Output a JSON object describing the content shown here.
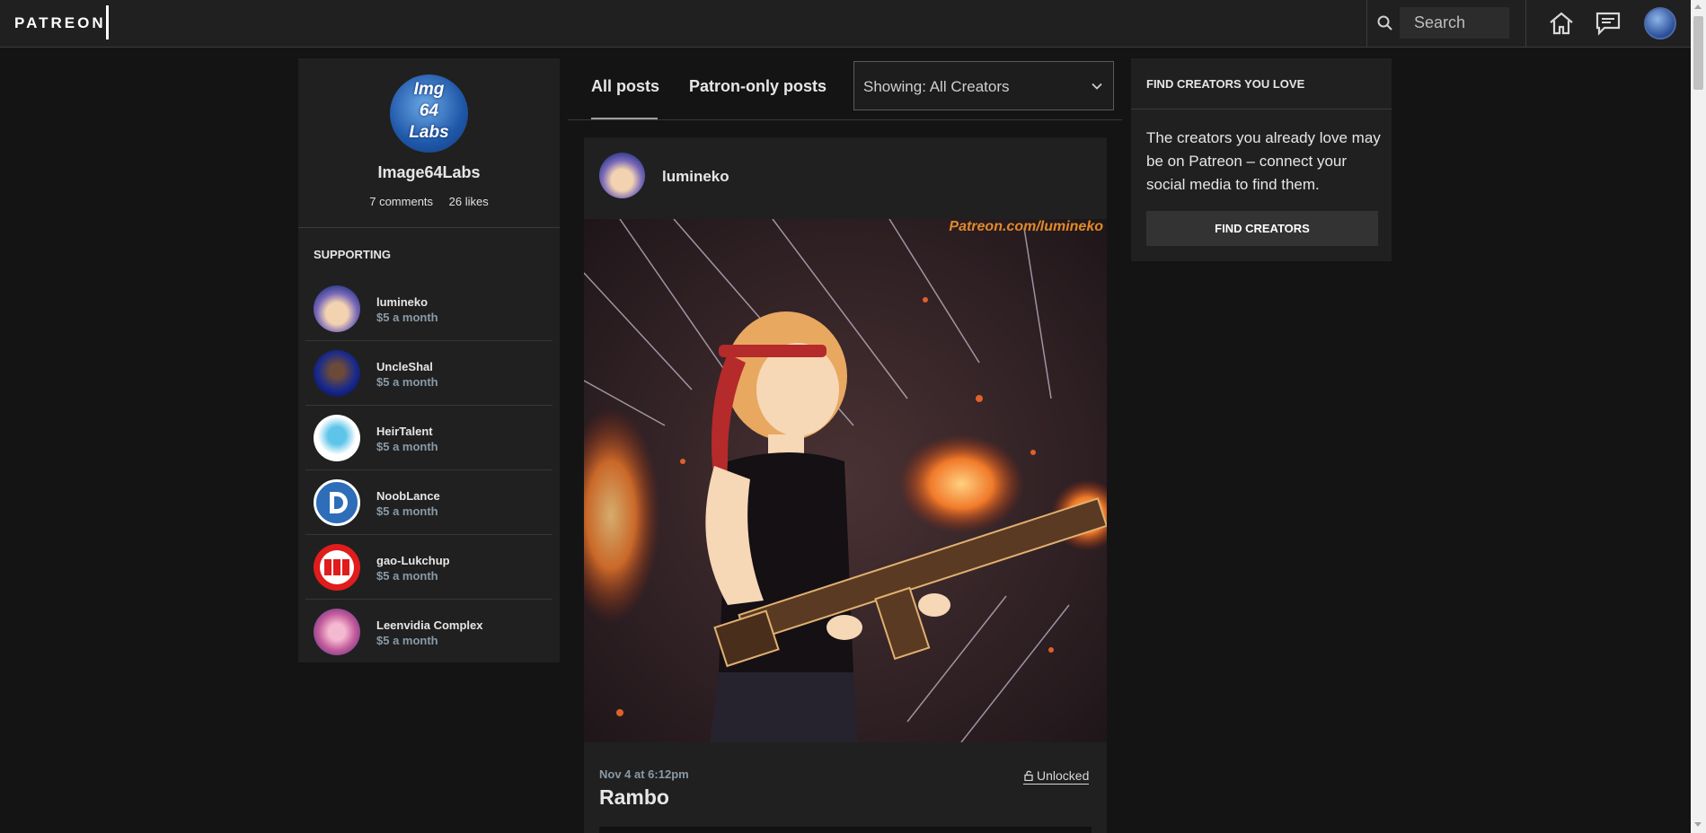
{
  "header": {
    "logo": "PATREON",
    "search_placeholder": "Search",
    "icons": [
      "search-icon",
      "home-icon",
      "messages-icon",
      "user-avatar"
    ]
  },
  "profile": {
    "name": "Image64Labs",
    "avatar_text": [
      "Img",
      "64",
      "Labs"
    ],
    "comments": "7 comments",
    "likes": "26 likes"
  },
  "supporting": {
    "title": "SUPPORTING",
    "items": [
      {
        "name": "lumineko",
        "price": "$5 a month"
      },
      {
        "name": "UncleShal",
        "price": "$5 a month"
      },
      {
        "name": "HeirTalent",
        "price": "$5 a month"
      },
      {
        "name": "NoobLance",
        "price": "$5 a month"
      },
      {
        "name": "gao-Lukchup",
        "price": "$5 a month"
      },
      {
        "name": "Leenvidia Complex",
        "price": "$5 a month"
      }
    ]
  },
  "feed": {
    "tabs": [
      {
        "label": "All posts",
        "active": true
      },
      {
        "label": "Patron-only posts",
        "active": false
      }
    ],
    "filter_label": "Showing: All Creators"
  },
  "post": {
    "creator": "lumineko",
    "watermark": "Patreon.com/lumineko",
    "date": "Nov 4 at 6:12pm",
    "status": "Unlocked",
    "title": "Rambo"
  },
  "find_creators": {
    "title": "FIND CREATORS YOU LOVE",
    "text": "The creators you already love may be on Patreon – connect your social media to find them.",
    "button_label": "FIND CREATORS"
  },
  "colors": {
    "background": "#141414",
    "panel": "#202020",
    "muted_text": "#8a9aa6"
  }
}
